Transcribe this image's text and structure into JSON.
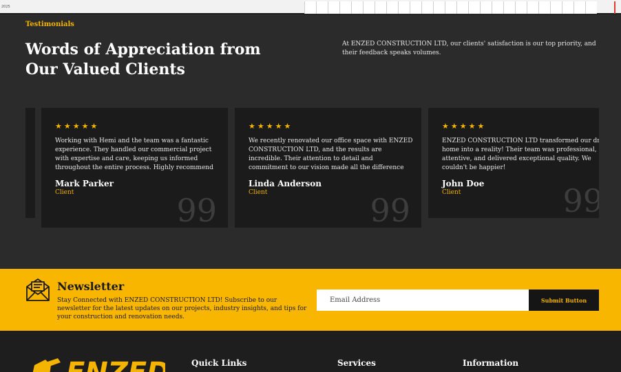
{
  "topbar": {
    "tiny_text": "2025"
  },
  "colors": {
    "accent": "#f5b400",
    "dark_bg": "#2b2b2b",
    "card_bg": "#1b1b1b",
    "newsletter_bg": "#f9b600"
  },
  "testimonials": {
    "label": "Testimonials",
    "title": "Words of Appreciation from Our Valued Clients",
    "description": "At ENZED CONSTRUCTION LTD, our clients' satisfaction is our top priority, and their feedback speaks volumes.",
    "cards": [
      {
        "stars": "★★★★★",
        "rating": 5,
        "quote": "Working with Hemi and the team was a fantastic experience. They handled our commercial project with expertise and care, keeping us informed throughout the entire process. Highly recommend",
        "name": "Mark Parker",
        "role": "Client",
        "quote_icon": "99"
      },
      {
        "stars": "★★★★★",
        "rating": 5,
        "quote": "We recently renovated our office space with ENZED CONSTRUCTION LTD, and the results are incredible. Their attention to detail and commitment to our vision made all the difference",
        "name": "Linda Anderson",
        "role": "Client",
        "quote_icon": "99"
      },
      {
        "stars": "★★★★★",
        "rating": 5,
        "quote": "ENZED CONSTRUCTION LTD transformed our dream home into a reality! Their team was professional, attentive, and delivered exceptional quality. We couldn't be happier!",
        "name": "John Doe",
        "role": "Client",
        "quote_icon": "99"
      }
    ]
  },
  "newsletter": {
    "icon": "newsletter-envelope-icon",
    "title": "Newsletter",
    "text": "Stay Connected with ENZED CONSTRUCTION LTD! Subscribe to our newsletter for the latest updates on our projects, industry insights, and tips for your construction and renovation needs.",
    "placeholder": "Email Address",
    "button_label": "Submit Button"
  },
  "footer": {
    "logo_text": "ENZED",
    "columns": [
      "Quick Links",
      "Services",
      "Information"
    ]
  }
}
